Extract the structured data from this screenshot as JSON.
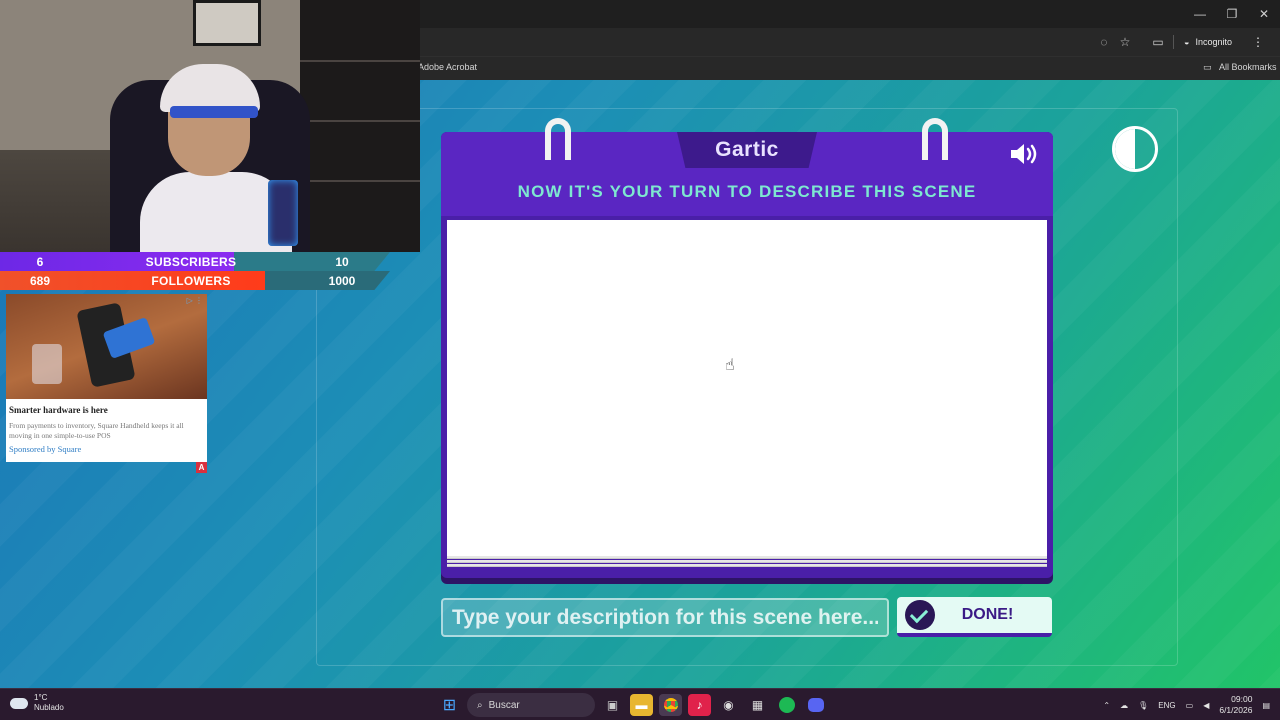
{
  "browser": {
    "incognito_label": "Incognito",
    "bookmark_adobe": "Adobe Acrobat",
    "all_bookmarks": "All Bookmarks",
    "window_controls": [
      "—",
      "❐",
      "✕"
    ]
  },
  "game": {
    "logo": "Gartic",
    "prompt": "NOW IT'S YOUR TURN TO DESCRIBE THIS SCENE",
    "input_placeholder": "Type your description for this scene here...",
    "done_label": "DONE!",
    "colors": {
      "card": "#4a1fa8",
      "prompt": "#7ee8d0",
      "done_bg": "#e4faf4"
    }
  },
  "overlay": {
    "stats": [
      {
        "left": "6",
        "label": "SUBSCRIBERS",
        "right": "10"
      },
      {
        "left": "689",
        "label": "FOLLOWERS",
        "right": "1000"
      }
    ]
  },
  "ad": {
    "title": "Smarter hardware is here",
    "body": "From payments to inventory, Square Handheld keeps it all moving in one simple-to-use POS",
    "sponsor": "Sponsored by Square",
    "badge": "A"
  },
  "taskbar": {
    "temp": "1°C",
    "condition": "Nublado",
    "search_label": "Buscar",
    "lang": "ENG",
    "time": "09:00",
    "date": "6/1/2026"
  }
}
